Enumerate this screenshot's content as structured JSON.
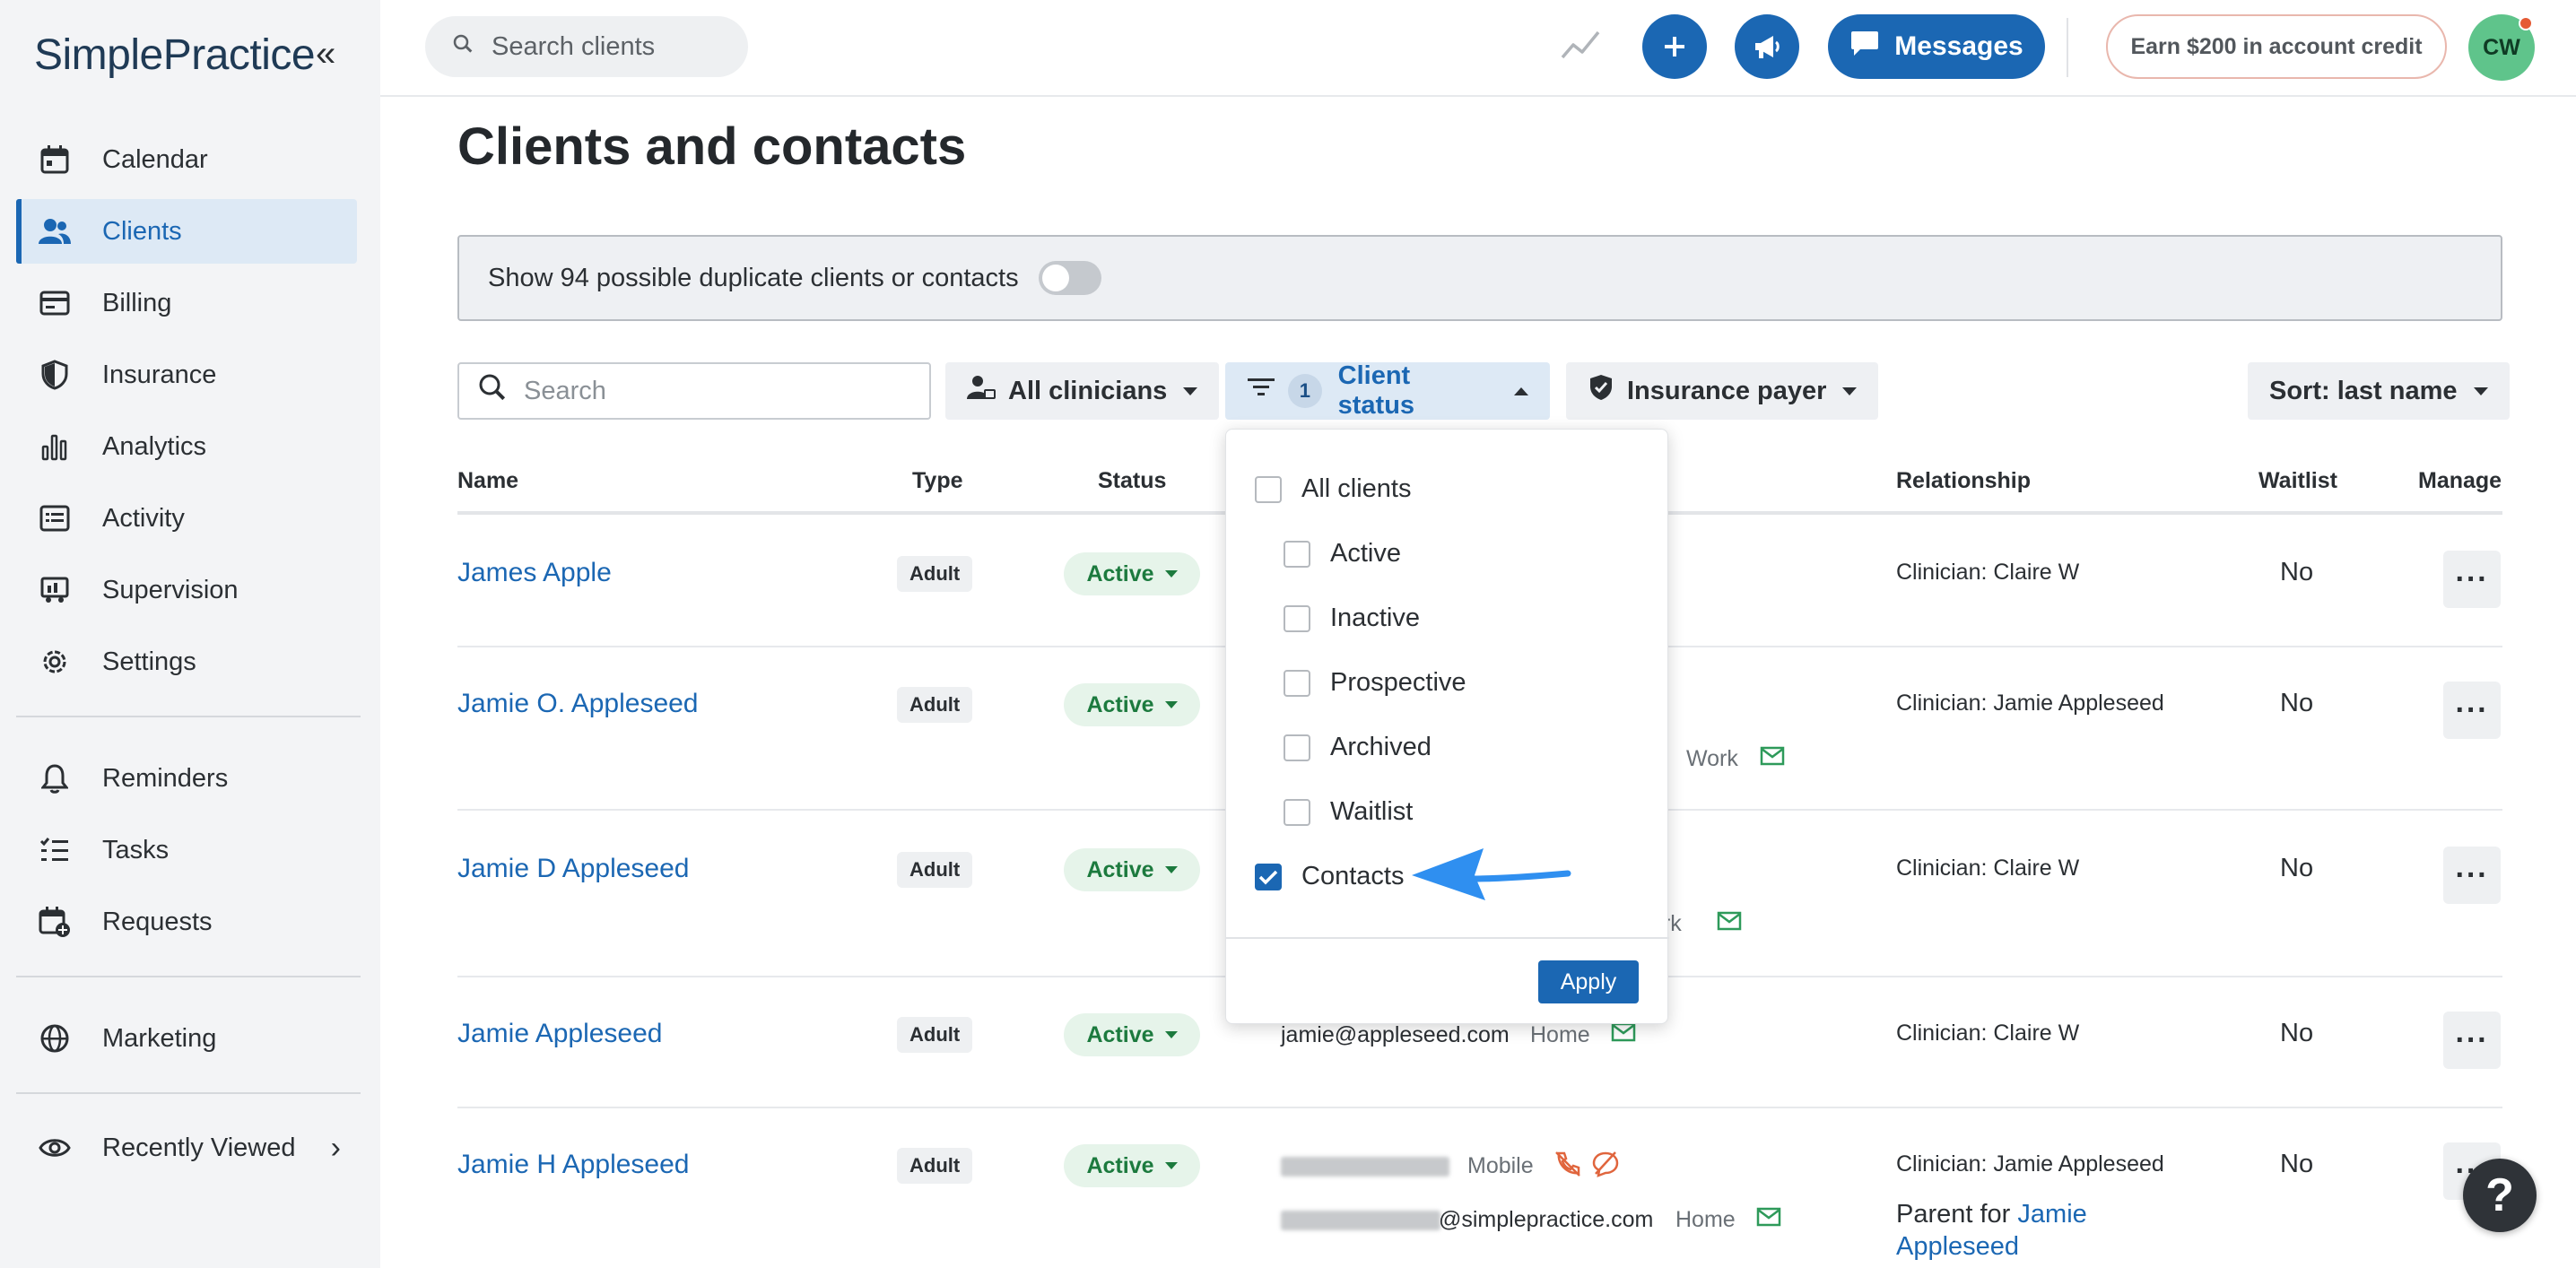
{
  "sidebar": {
    "logo": "SimplePractice",
    "items": [
      {
        "label": "Calendar",
        "icon": "calendar-icon"
      },
      {
        "label": "Clients",
        "icon": "users-icon",
        "active": true
      },
      {
        "label": "Billing",
        "icon": "credit-card-icon"
      },
      {
        "label": "Insurance",
        "icon": "shield-icon"
      },
      {
        "label": "Analytics",
        "icon": "bar-chart-icon"
      },
      {
        "label": "Activity",
        "icon": "list-icon"
      },
      {
        "label": "Supervision",
        "icon": "supervision-icon"
      },
      {
        "label": "Settings",
        "icon": "gear-icon"
      }
    ],
    "secondary": [
      {
        "label": "Reminders",
        "icon": "bell-icon"
      },
      {
        "label": "Tasks",
        "icon": "tasks-icon"
      },
      {
        "label": "Requests",
        "icon": "calendar-plus-icon"
      }
    ],
    "marketing": {
      "label": "Marketing",
      "icon": "globe-icon"
    },
    "recent": {
      "label": "Recently Viewed",
      "icon": "eye-icon"
    }
  },
  "topbar": {
    "search_placeholder": "Search clients",
    "messages_label": "Messages",
    "earn_label": "Earn $200 in account credit",
    "avatar_initials": "CW"
  },
  "page": {
    "title": "Clients and contacts",
    "duplicate_banner": "Show 94 possible duplicate clients or contacts"
  },
  "filters": {
    "search_placeholder": "Search",
    "clinicians": "All clinicians",
    "status_count": "1",
    "status": "Client status",
    "insurance": "Insurance payer",
    "sort": "Sort: last name"
  },
  "table": {
    "headers": {
      "name": "Name",
      "type": "Type",
      "status": "Status",
      "relationship": "Relationship",
      "waitlist": "Waitlist",
      "manage": "Manage"
    },
    "rows": [
      {
        "name": "James Apple",
        "type": "Adult",
        "status": "Active",
        "relationship": "Clinician: Claire W",
        "waitlist": "No"
      },
      {
        "name": "Jamie O. Appleseed",
        "type": "Adult",
        "status": "Active",
        "relationship": "Clinician: Jamie Appleseed",
        "waitlist": "No",
        "contact_type": "Work"
      },
      {
        "name": "Jamie D Appleseed",
        "type": "Adult",
        "status": "Active",
        "relationship": "Clinician: Claire W",
        "waitlist": "No",
        "contact_type": "ork"
      },
      {
        "name": "Jamie Appleseed",
        "type": "Adult",
        "status": "Active",
        "relationship": "Clinician: Claire W",
        "waitlist": "No",
        "email": "jamie@appleseed.com",
        "contact_type": "Home"
      },
      {
        "name": "Jamie H Appleseed",
        "type": "Adult",
        "status": "Active",
        "relationship": "Clinician: Jamie Appleseed",
        "waitlist": "No",
        "phone_type": "Mobile",
        "email_suffix": "@simplepractice.com",
        "email_type": "Home",
        "parent_prefix": "Parent for",
        "parent_link": "Jamie Appleseed"
      }
    ]
  },
  "status_dropdown": {
    "all": "All clients",
    "options": [
      "Active",
      "Inactive",
      "Prospective",
      "Archived",
      "Waitlist"
    ],
    "contacts": "Contacts",
    "apply": "Apply"
  },
  "help_label": "?",
  "colors": {
    "primary": "#1b67b3",
    "active_green": "#1c7a3e",
    "arrow": "#2f8ff0"
  }
}
